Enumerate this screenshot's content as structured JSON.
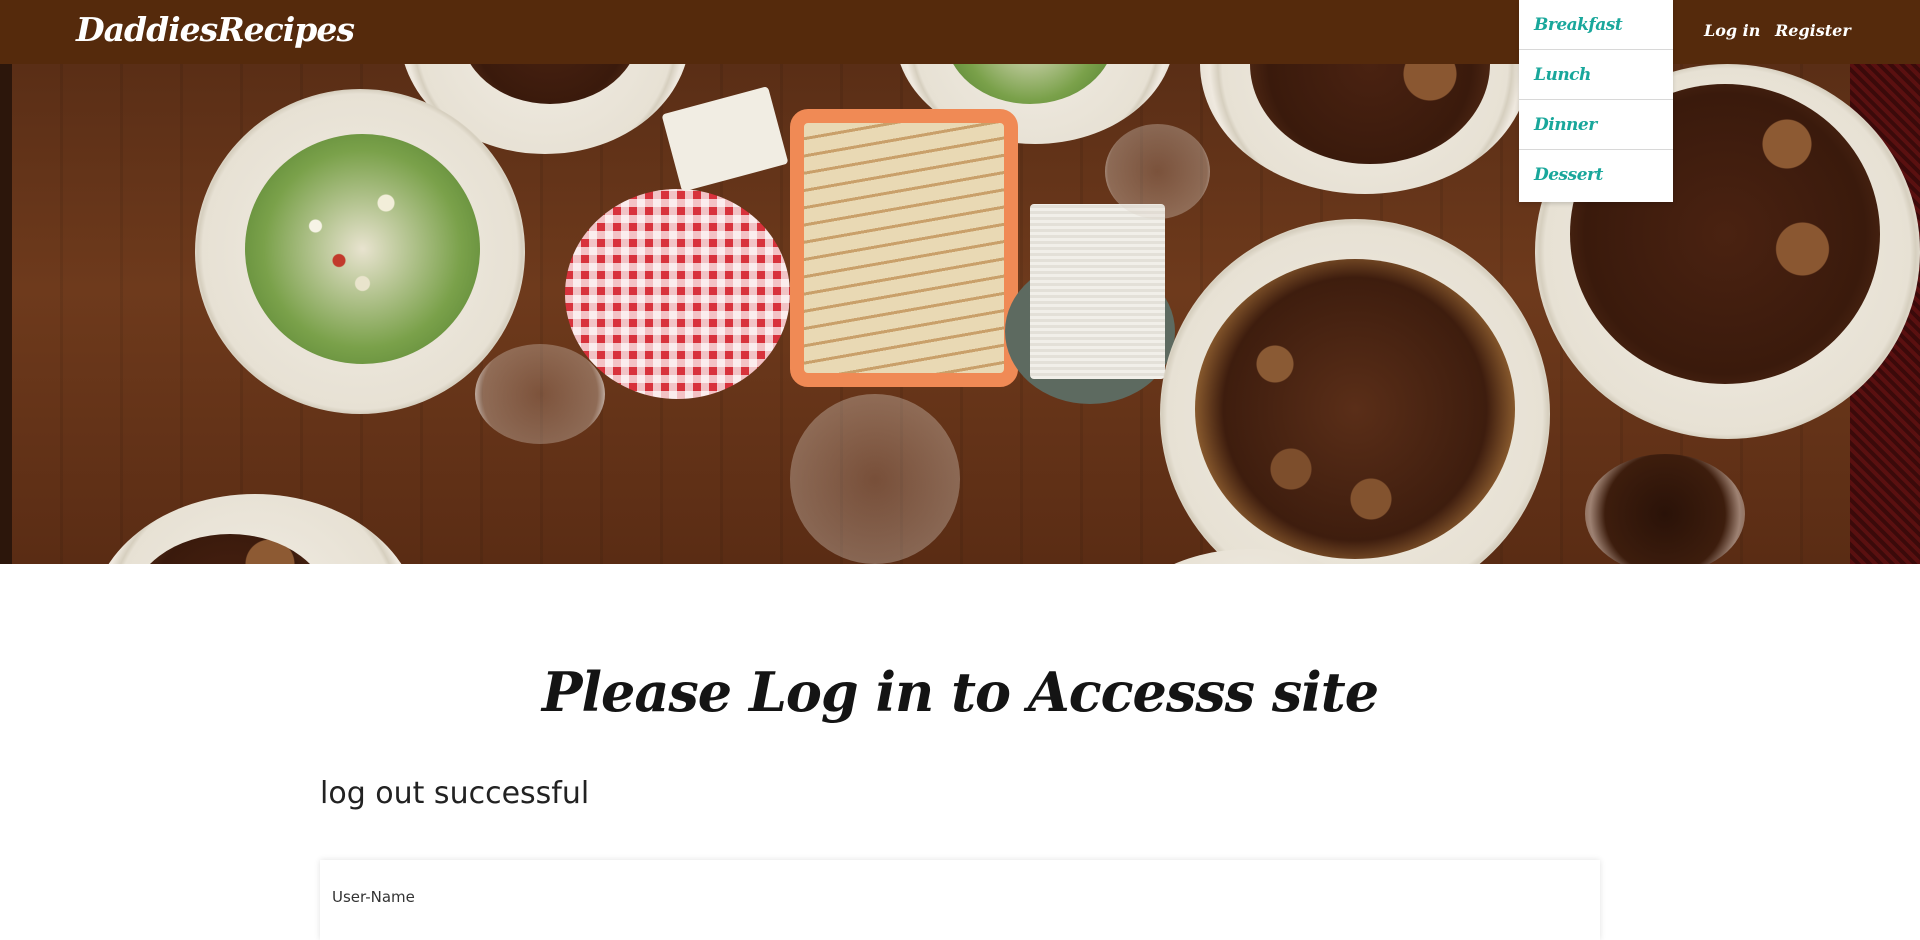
{
  "navbar": {
    "brand": "DaddiesRecipes",
    "login_label": "Log in",
    "register_label": "Register",
    "dropdown_items": [
      "Breakfast",
      "Lunch",
      "Dinner",
      "Dessert"
    ]
  },
  "main": {
    "heading": "Please Log in to Accesss site",
    "status_message": "log out successful",
    "form": {
      "username_label": "User-Name"
    }
  },
  "colors": {
    "navbar_bg": "#552a0c",
    "dropdown_text": "#19a79b"
  }
}
